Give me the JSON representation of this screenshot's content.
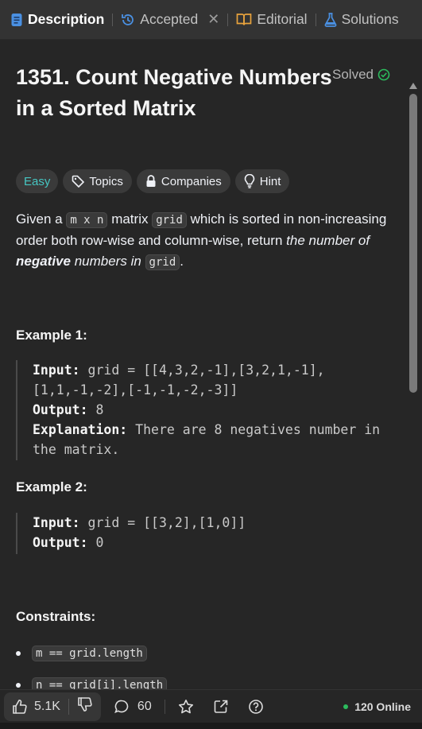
{
  "tabs": {
    "description": "Description",
    "accepted": "Accepted",
    "editorial": "Editorial",
    "solutions": "Solutions"
  },
  "problem": {
    "title": "1351. Count Negative Numbers in a Sorted Matrix",
    "status": "Solved",
    "tags": {
      "difficulty": "Easy",
      "topics": "Topics",
      "companies": "Companies",
      "hint": "Hint"
    },
    "description": {
      "p1": "Given a ",
      "code1": "m x n",
      "p2": " matrix ",
      "code2": "grid",
      "p3": " which is sorted in non-increasing order both row-wise and column-wise, return ",
      "em1": "the number of ",
      "strong1": "negative",
      "em2": " numbers in ",
      "code3": "grid",
      "p4": "."
    }
  },
  "examples": [
    {
      "heading": "Example 1:",
      "input_label": "Input:",
      "input_value": " grid = [[4,3,2,-1],[3,2,1,-1],[1,1,-1,-2],[-1,-1,-2,-3]]",
      "output_label": "Output:",
      "output_value": " 8",
      "explanation_label": "Explanation:",
      "explanation_value": " There are 8 negatives number in the matrix."
    },
    {
      "heading": "Example 2:",
      "input_label": "Input:",
      "input_value": " grid = [[3,2],[1,0]]",
      "output_label": "Output:",
      "output_value": " 0"
    }
  ],
  "constraints": {
    "heading": "Constraints:",
    "items": [
      "m == grid.length",
      "n == grid[i].length"
    ]
  },
  "footer": {
    "likes": "5.1K",
    "comments": "60",
    "online": "120 Online"
  },
  "colors": {
    "easy": "#46c6c2",
    "solved_check": "#2cbb5d",
    "online_dot": "#2cbb5d"
  }
}
